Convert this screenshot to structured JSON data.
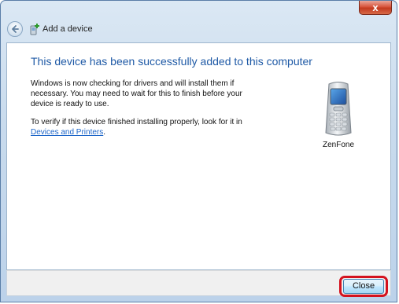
{
  "titlebar": {
    "close_glyph": "x"
  },
  "nav": {
    "back_icon": "back-arrow-icon",
    "wizard_icon": "add-device-icon",
    "title": "Add a device"
  },
  "main": {
    "headline": "This device has been successfully added to this computer",
    "paragraph1": "Windows is now checking for drivers and will install them if necessary. You may need to wait for this to finish before your device is ready to use.",
    "paragraph2_prefix": "To verify if this device finished installing properly, look for it in",
    "paragraph2_link": "Devices and Printers",
    "paragraph2_suffix": "."
  },
  "device": {
    "icon": "mobile-phone-icon",
    "name": "ZenFone"
  },
  "footer": {
    "close_label": "Close"
  },
  "colors": {
    "headline": "#1f5aa6",
    "link": "#1b64c8",
    "highlight_ring": "#d4121e"
  }
}
